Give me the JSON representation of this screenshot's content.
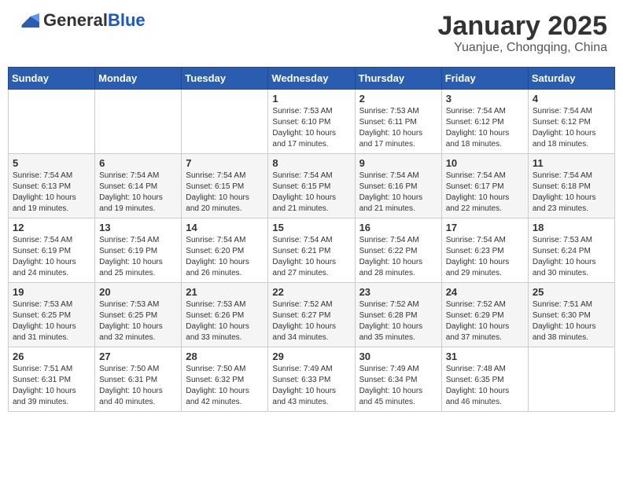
{
  "header": {
    "logo_general": "General",
    "logo_blue": "Blue",
    "title": "January 2025",
    "subtitle": "Yuanjue, Chongqing, China"
  },
  "weekdays": [
    "Sunday",
    "Monday",
    "Tuesday",
    "Wednesday",
    "Thursday",
    "Friday",
    "Saturday"
  ],
  "weeks": [
    [
      {
        "day": "",
        "info": ""
      },
      {
        "day": "",
        "info": ""
      },
      {
        "day": "",
        "info": ""
      },
      {
        "day": "1",
        "info": "Sunrise: 7:53 AM\nSunset: 6:10 PM\nDaylight: 10 hours\nand 17 minutes."
      },
      {
        "day": "2",
        "info": "Sunrise: 7:53 AM\nSunset: 6:11 PM\nDaylight: 10 hours\nand 17 minutes."
      },
      {
        "day": "3",
        "info": "Sunrise: 7:54 AM\nSunset: 6:12 PM\nDaylight: 10 hours\nand 18 minutes."
      },
      {
        "day": "4",
        "info": "Sunrise: 7:54 AM\nSunset: 6:12 PM\nDaylight: 10 hours\nand 18 minutes."
      }
    ],
    [
      {
        "day": "5",
        "info": "Sunrise: 7:54 AM\nSunset: 6:13 PM\nDaylight: 10 hours\nand 19 minutes."
      },
      {
        "day": "6",
        "info": "Sunrise: 7:54 AM\nSunset: 6:14 PM\nDaylight: 10 hours\nand 19 minutes."
      },
      {
        "day": "7",
        "info": "Sunrise: 7:54 AM\nSunset: 6:15 PM\nDaylight: 10 hours\nand 20 minutes."
      },
      {
        "day": "8",
        "info": "Sunrise: 7:54 AM\nSunset: 6:15 PM\nDaylight: 10 hours\nand 21 minutes."
      },
      {
        "day": "9",
        "info": "Sunrise: 7:54 AM\nSunset: 6:16 PM\nDaylight: 10 hours\nand 21 minutes."
      },
      {
        "day": "10",
        "info": "Sunrise: 7:54 AM\nSunset: 6:17 PM\nDaylight: 10 hours\nand 22 minutes."
      },
      {
        "day": "11",
        "info": "Sunrise: 7:54 AM\nSunset: 6:18 PM\nDaylight: 10 hours\nand 23 minutes."
      }
    ],
    [
      {
        "day": "12",
        "info": "Sunrise: 7:54 AM\nSunset: 6:19 PM\nDaylight: 10 hours\nand 24 minutes."
      },
      {
        "day": "13",
        "info": "Sunrise: 7:54 AM\nSunset: 6:19 PM\nDaylight: 10 hours\nand 25 minutes."
      },
      {
        "day": "14",
        "info": "Sunrise: 7:54 AM\nSunset: 6:20 PM\nDaylight: 10 hours\nand 26 minutes."
      },
      {
        "day": "15",
        "info": "Sunrise: 7:54 AM\nSunset: 6:21 PM\nDaylight: 10 hours\nand 27 minutes."
      },
      {
        "day": "16",
        "info": "Sunrise: 7:54 AM\nSunset: 6:22 PM\nDaylight: 10 hours\nand 28 minutes."
      },
      {
        "day": "17",
        "info": "Sunrise: 7:54 AM\nSunset: 6:23 PM\nDaylight: 10 hours\nand 29 minutes."
      },
      {
        "day": "18",
        "info": "Sunrise: 7:53 AM\nSunset: 6:24 PM\nDaylight: 10 hours\nand 30 minutes."
      }
    ],
    [
      {
        "day": "19",
        "info": "Sunrise: 7:53 AM\nSunset: 6:25 PM\nDaylight: 10 hours\nand 31 minutes."
      },
      {
        "day": "20",
        "info": "Sunrise: 7:53 AM\nSunset: 6:25 PM\nDaylight: 10 hours\nand 32 minutes."
      },
      {
        "day": "21",
        "info": "Sunrise: 7:53 AM\nSunset: 6:26 PM\nDaylight: 10 hours\nand 33 minutes."
      },
      {
        "day": "22",
        "info": "Sunrise: 7:52 AM\nSunset: 6:27 PM\nDaylight: 10 hours\nand 34 minutes."
      },
      {
        "day": "23",
        "info": "Sunrise: 7:52 AM\nSunset: 6:28 PM\nDaylight: 10 hours\nand 35 minutes."
      },
      {
        "day": "24",
        "info": "Sunrise: 7:52 AM\nSunset: 6:29 PM\nDaylight: 10 hours\nand 37 minutes."
      },
      {
        "day": "25",
        "info": "Sunrise: 7:51 AM\nSunset: 6:30 PM\nDaylight: 10 hours\nand 38 minutes."
      }
    ],
    [
      {
        "day": "26",
        "info": "Sunrise: 7:51 AM\nSunset: 6:31 PM\nDaylight: 10 hours\nand 39 minutes."
      },
      {
        "day": "27",
        "info": "Sunrise: 7:50 AM\nSunset: 6:31 PM\nDaylight: 10 hours\nand 40 minutes."
      },
      {
        "day": "28",
        "info": "Sunrise: 7:50 AM\nSunset: 6:32 PM\nDaylight: 10 hours\nand 42 minutes."
      },
      {
        "day": "29",
        "info": "Sunrise: 7:49 AM\nSunset: 6:33 PM\nDaylight: 10 hours\nand 43 minutes."
      },
      {
        "day": "30",
        "info": "Sunrise: 7:49 AM\nSunset: 6:34 PM\nDaylight: 10 hours\nand 45 minutes."
      },
      {
        "day": "31",
        "info": "Sunrise: 7:48 AM\nSunset: 6:35 PM\nDaylight: 10 hours\nand 46 minutes."
      },
      {
        "day": "",
        "info": ""
      }
    ]
  ]
}
